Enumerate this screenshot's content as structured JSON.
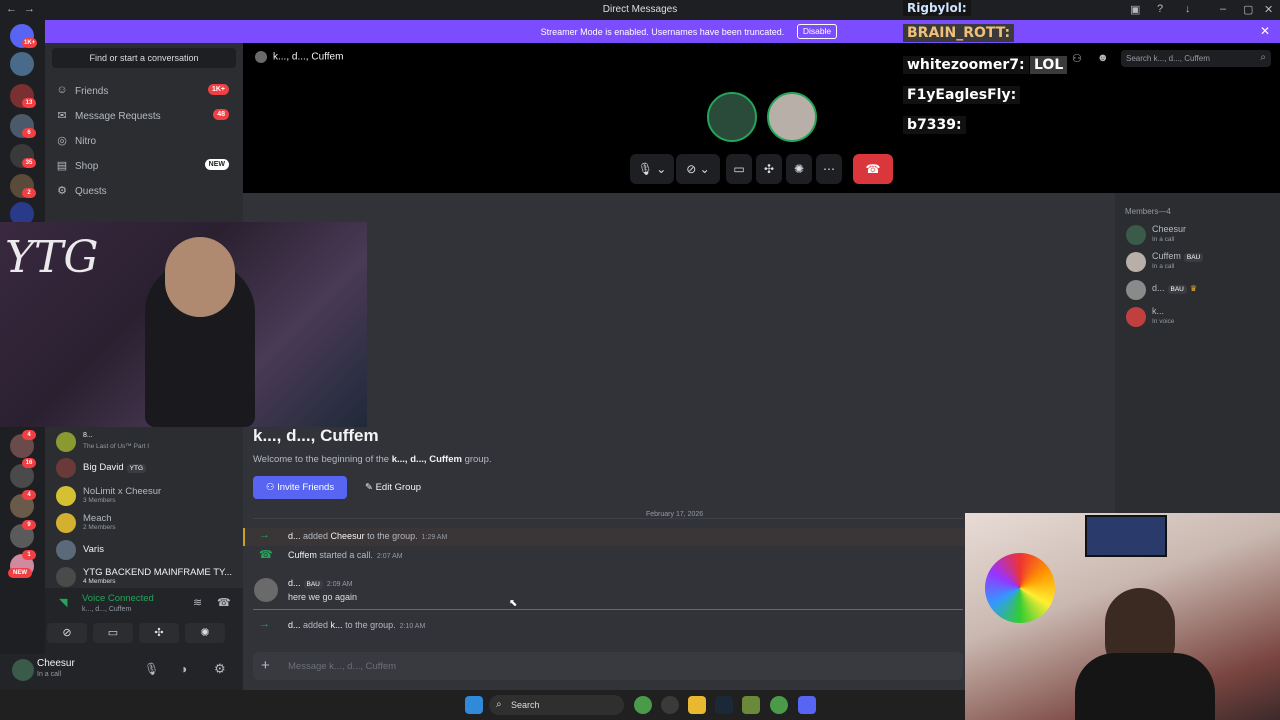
{
  "window": {
    "title": "Direct Messages"
  },
  "banner": {
    "text": "Streamer Mode is enabled. Usernames have been truncated.",
    "button": "Disable"
  },
  "rail": {
    "badges": [
      "1K+",
      "13",
      "6",
      "35",
      "2",
      "4",
      "16",
      "4",
      "9",
      "1",
      "NEW"
    ]
  },
  "dm_sidebar": {
    "search_placeholder": "Find or start a conversation",
    "nav": [
      {
        "label": "Friends",
        "badge": "1K+"
      },
      {
        "label": "Message Requests",
        "badge": "48"
      },
      {
        "label": "Nitro",
        "badge": ""
      },
      {
        "label": "Shop",
        "badge": "NEW"
      },
      {
        "label": "Quests",
        "badge": ""
      }
    ],
    "dms": [
      {
        "name": "8...",
        "sub": "The Last of Us™ Part I"
      },
      {
        "name": "Big David",
        "tag": "YTG",
        "sub": ""
      },
      {
        "name": "NoLimit x Cheesur",
        "sub": "3 Members"
      },
      {
        "name": "Meach",
        "sub": "2 Members"
      },
      {
        "name": "Varis",
        "sub": ""
      },
      {
        "name": "YTG BACKEND MAINFRAME TY...",
        "sub": "4 Members"
      }
    ]
  },
  "voice": {
    "status": "Voice Connected",
    "channel": "k..., d..., Cuffem"
  },
  "user": {
    "name": "Cheesur",
    "status": "In a call"
  },
  "chat": {
    "header": "k..., d..., Cuffem",
    "title": "k...,  d...,  Cuffem",
    "welcome_prefix": "Welcome to the beginning of the ",
    "welcome_group": "k..., d..., Cuffem",
    "welcome_suffix": " group.",
    "invite_button": "Invite Friends",
    "edit_button": "Edit Group",
    "date_divider": "February 17, 2026",
    "messages": [
      {
        "actor": "d...",
        "action": " added ",
        "target": "Cheesur",
        "rest": " to the group.",
        "time": "1:29 AM"
      },
      {
        "actor": "Cuffem",
        "action": " started a call.",
        "target": "",
        "rest": "",
        "time": "2:07 AM"
      },
      {
        "actor": "d...",
        "tag": "BAU",
        "time": "2:09 AM",
        "text": "here we go again"
      },
      {
        "actor": "d...",
        "action": " added ",
        "target": "k...",
        "rest": " to the group.",
        "time": "2:10 AM"
      }
    ],
    "composer_placeholder": "Message k..., d..., Cuffem"
  },
  "header_search": {
    "placeholder": "Search k..., d..., Cuffem"
  },
  "members": {
    "header": "Members—4",
    "list": [
      {
        "name": "Cheesur",
        "tag": "",
        "status": "In a call"
      },
      {
        "name": "Cuffem",
        "tag": "BAU",
        "status": "In a call"
      },
      {
        "name": "d...",
        "tag": "BAU",
        "status": ""
      },
      {
        "name": "k...",
        "tag": "",
        "status": "In voice"
      }
    ]
  },
  "overlay_chat": [
    "Rigbylol:",
    "BRAIN_ROTT:",
    "whitezoomer7:",
    "LOL",
    "F1yEaglesFly:",
    "b7339:"
  ],
  "webcam_text": "YTG",
  "taskbar": {
    "search": "Search"
  },
  "colors": {
    "accent": "#5865f2",
    "banner": "#7c4dff",
    "green": "#23a55a",
    "red": "#da373c"
  }
}
